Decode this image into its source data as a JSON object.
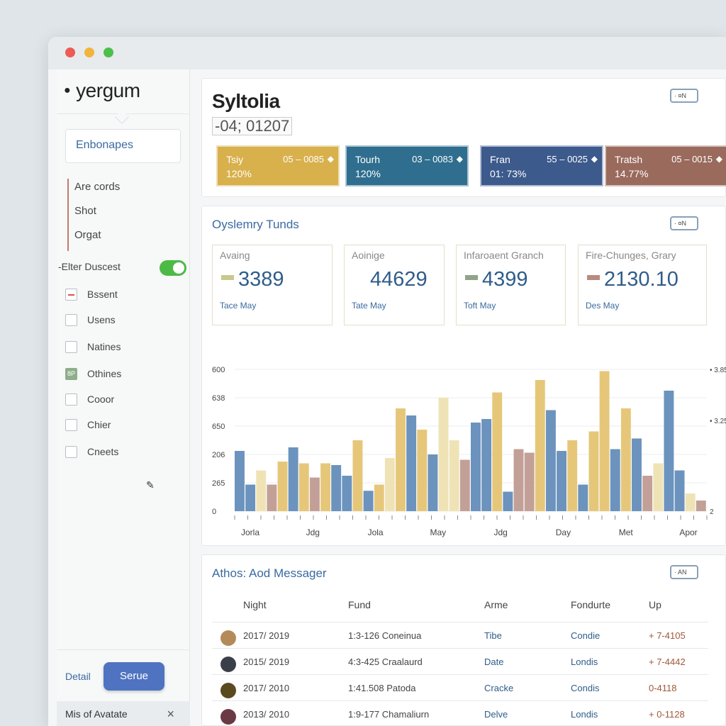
{
  "window": {
    "controls": [
      "close",
      "minimize",
      "maximize"
    ]
  },
  "sidebar": {
    "brand": "yergum",
    "brand_icon": "apple-icon",
    "search_value": "Enbonapes",
    "nav_items": [
      "Are cords",
      "Shot",
      "Orgat"
    ],
    "filter_label": "-Elter Duscest",
    "filter_toggle_on": true,
    "checklist": [
      {
        "label": "Bssent",
        "state": "red"
      },
      {
        "label": "Usens",
        "state": "empty"
      },
      {
        "label": "Natines",
        "state": "empty"
      },
      {
        "label": "Othines",
        "state": "green",
        "mark": "8P"
      },
      {
        "label": "Cooor",
        "state": "empty"
      },
      {
        "label": "Chier",
        "state": "empty"
      },
      {
        "label": "Cneets",
        "state": "empty"
      }
    ],
    "pencil_icon": "pencil-icon",
    "detail_link": "Detail",
    "save_button": "Serue",
    "footer_text": "Mis of Avatate",
    "footer_close": "×"
  },
  "header": {
    "title": "Syltolia",
    "subtitle": "-04; 01207",
    "switch_label": "· ¤N",
    "tiles": [
      {
        "name": "Tsiy",
        "range": "05 – 0085",
        "pct": "120%",
        "color": "#d8b04c"
      },
      {
        "name": "Tourh",
        "range": "03 – 0083",
        "pct": "120%",
        "color": "#2f6e8e"
      },
      {
        "name": "Fran",
        "range": "55 – 0025",
        "pct": "01: 73%",
        "color": "#3c5a8c"
      },
      {
        "name": "Tratsh",
        "range": "05 – 0015",
        "pct": "14.77%",
        "color": "#9a6a5c"
      }
    ]
  },
  "metrics": {
    "title": "Oyslemry Tunds",
    "switch_label": "· ¤N",
    "cards": [
      {
        "label": "Avaing",
        "value": "3389",
        "foot": "Tace May",
        "swatch": "#c8c98e"
      },
      {
        "label": "Aoinige",
        "value": "44629",
        "foot": "Tate May",
        "swatch": "#ffffff"
      },
      {
        "label": "Infaroaent Granch",
        "value": "4399",
        "foot": "Toft May",
        "swatch": "#8fa38a"
      },
      {
        "label": "Fire-Chunges, Grary",
        "value": "2130.10",
        "foot": "Des May",
        "swatch": "#b98a7e"
      }
    ]
  },
  "chart_data": {
    "type": "bar",
    "y_tick_labels": [
      "600",
      "638",
      "650",
      "206",
      "265",
      "0"
    ],
    "y_right_tick_labels": [
      "• 3.85",
      "• 3.25",
      "2"
    ],
    "x_tick_labels": [
      "Jorla",
      "Jdg",
      "Jola",
      "May",
      "Jdg",
      "Day",
      "Met",
      "Apor"
    ],
    "ylim": [
      0,
      800
    ],
    "grid": true,
    "series_colors": [
      "#6b93bd",
      "#e6c77a",
      "#c3a097",
      "#efe3b6"
    ],
    "bars": [
      {
        "value": 340,
        "color": 0
      },
      {
        "value": 150,
        "color": 0
      },
      {
        "value": 230,
        "color": 3
      },
      {
        "value": 150,
        "color": 2
      },
      {
        "value": 280,
        "color": 1
      },
      {
        "value": 360,
        "color": 0
      },
      {
        "value": 270,
        "color": 1
      },
      {
        "value": 190,
        "color": 2
      },
      {
        "value": 270,
        "color": 1
      },
      {
        "value": 260,
        "color": 0
      },
      {
        "value": 200,
        "color": 0
      },
      {
        "value": 400,
        "color": 1
      },
      {
        "value": 115,
        "color": 0
      },
      {
        "value": 150,
        "color": 1
      },
      {
        "value": 300,
        "color": 3
      },
      {
        "value": 580,
        "color": 1
      },
      {
        "value": 540,
        "color": 0
      },
      {
        "value": 460,
        "color": 1
      },
      {
        "value": 320,
        "color": 0
      },
      {
        "value": 640,
        "color": 3
      },
      {
        "value": 400,
        "color": 3
      },
      {
        "value": 290,
        "color": 2
      },
      {
        "value": 500,
        "color": 0
      },
      {
        "value": 520,
        "color": 0
      },
      {
        "value": 670,
        "color": 1
      },
      {
        "value": 110,
        "color": 0
      },
      {
        "value": 350,
        "color": 2
      },
      {
        "value": 330,
        "color": 2
      },
      {
        "value": 740,
        "color": 1
      },
      {
        "value": 570,
        "color": 0
      },
      {
        "value": 340,
        "color": 0
      },
      {
        "value": 400,
        "color": 1
      },
      {
        "value": 150,
        "color": 0
      },
      {
        "value": 450,
        "color": 1
      },
      {
        "value": 790,
        "color": 1
      },
      {
        "value": 350,
        "color": 0
      },
      {
        "value": 580,
        "color": 1
      },
      {
        "value": 410,
        "color": 0
      },
      {
        "value": 200,
        "color": 2
      },
      {
        "value": 270,
        "color": 3
      },
      {
        "value": 680,
        "color": 0
      },
      {
        "value": 230,
        "color": 0
      },
      {
        "value": 100,
        "color": 3
      },
      {
        "value": 60,
        "color": 2
      }
    ]
  },
  "messages": {
    "title": "Athos: Aod Messager",
    "switch_label": "· AN",
    "columns": [
      "Night",
      "Fund",
      "Arme",
      "Fondurte",
      "Up"
    ],
    "rows": [
      {
        "night": "2017/ 2019",
        "fund": "1:3-126 Coneinua",
        "arme": "Tibe",
        "fondurte": "Condie",
        "up": "+ 7-4105",
        "icon_color": "#b58a5a"
      },
      {
        "night": "2015/ 2019",
        "fund": "4:3-425 Craalaurd",
        "arme": "Date",
        "fondurte": "Londis",
        "up": "+ 7-4442",
        "icon_color": "#3b3f4a"
      },
      {
        "night": "2017/ 2010",
        "fund": "1:41.508 Patoda",
        "arme": "Cracke",
        "fondurte": "Condis",
        "up": "0-4118",
        "icon_color": "#5b4a1e"
      },
      {
        "night": "2013/ 2010",
        "fund": "1:9-177 Chamaliurn",
        "arme": "Delve",
        "fondurte": "Londis",
        "up": "+ 0-1128",
        "icon_color": "#6a3a44"
      }
    ]
  }
}
